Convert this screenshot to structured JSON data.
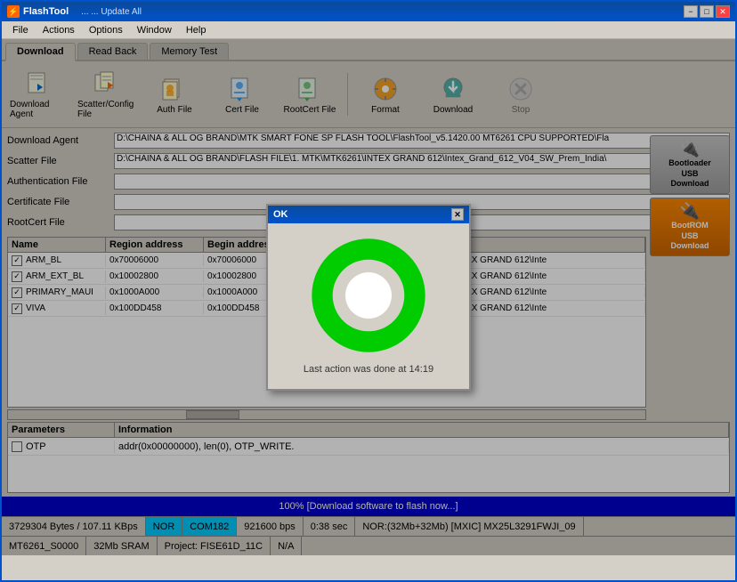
{
  "app": {
    "title": "FlashTool",
    "icon": "⚡"
  },
  "titlebar": {
    "title": "FlashTool",
    "extra": "  ...  ...  Update All",
    "minimize": "−",
    "maximize": "□",
    "close": "✕"
  },
  "menubar": {
    "items": [
      "File",
      "Actions",
      "Options",
      "Window",
      "Help"
    ]
  },
  "tabs": [
    {
      "label": "Download",
      "active": true
    },
    {
      "label": "Read Back",
      "active": false
    },
    {
      "label": "Memory Test",
      "active": false
    }
  ],
  "toolbar": {
    "buttons": [
      {
        "label": "Download Agent",
        "icon": "agent"
      },
      {
        "label": "Scatter/Config File",
        "icon": "scatter"
      },
      {
        "label": "Auth File",
        "icon": "auth"
      },
      {
        "label": "Cert File",
        "icon": "cert"
      },
      {
        "label": "RootCert File",
        "icon": "rootcert"
      },
      {
        "label": "Format",
        "icon": "format"
      },
      {
        "label": "Download",
        "icon": "download"
      },
      {
        "label": "Stop",
        "icon": "stop"
      }
    ]
  },
  "form": {
    "download_agent_label": "Download Agent",
    "download_agent_value": "D:\\CHAINA & ALL OG BRAND\\MTK SMART FONE SP FLASH TOOL\\FlashTool_v5.1420.00 MT6261 CPU SUPPORTED\\Fla",
    "scatter_file_label": "Scatter File",
    "scatter_file_value": "D:\\CHAINA & ALL OG BRAND\\FLASH FILE\\1. MTK\\MTK6261\\INTEX GRAND 612\\Intex_Grand_612_V04_SW_Prem_India\\",
    "auth_file_label": "Authentication File",
    "auth_file_value": "",
    "cert_file_label": "Certificate File",
    "cert_file_value": "",
    "rootcert_file_label": "RootCert File",
    "rootcert_file_value": ""
  },
  "table": {
    "headers": [
      "Name",
      "Region address",
      "Begin address",
      ""
    ],
    "rows": [
      {
        "checked": true,
        "name": "ARM_BL",
        "region": "0x70006000",
        "begin": "0x70006000",
        "path": "AND\\FLASH FILE\\1. MTK\\MTK6261\\INTEX GRAND 612\\Inte"
      },
      {
        "checked": true,
        "name": "ARM_EXT_BL",
        "region": "0x10002800",
        "begin": "0x10002800",
        "path": "AND\\FLASH FILE\\1. MTK\\MTK6261\\INTEX GRAND 612\\Inte"
      },
      {
        "checked": true,
        "name": "PRIMARY_MAUI",
        "region": "0x1000A000",
        "begin": "0x1000A000",
        "path": "AND\\FLASH FILE\\1. MTK\\MTK6261\\INTEX GRAND 612\\Inte"
      },
      {
        "checked": true,
        "name": "VIVA",
        "region": "0x100DD458",
        "begin": "0x100DD458",
        "path": "AND\\FLASH FILE\\1. MTK\\MTK6261\\INTEX GRAND 612\\Inte"
      }
    ]
  },
  "params": {
    "headers": [
      "Parameters",
      "Information"
    ],
    "rows": [
      {
        "checked": false,
        "param": "OTP",
        "info": "addr(0x00000000), len(0), OTP_WRITE."
      }
    ]
  },
  "usb_buttons": {
    "bootloader_label": "Bootloader\nUSB\nDownload",
    "bootrom_label": "BootROM\nUSB\nDownload"
  },
  "modal": {
    "title": "OK",
    "close": "✕",
    "status_text": "Last action was done at 14:19"
  },
  "status": {
    "progress_text": "100% [Download software to flash now...]",
    "bar1": {
      "bytes": "3729304 Bytes / 107.11 KBps",
      "nor": "NOR",
      "com": "COM182",
      "bps": "921600 bps",
      "time": "0:38 sec",
      "flash": "NOR:(32Mb+32Mb) [MXIC] MX25L3291FWJI_09"
    },
    "bar2": {
      "cpu": "MT6261_S0000",
      "ram": "32Mb SRAM",
      "project": "Project: FISE61D_11C",
      "na": "N/A"
    }
  }
}
